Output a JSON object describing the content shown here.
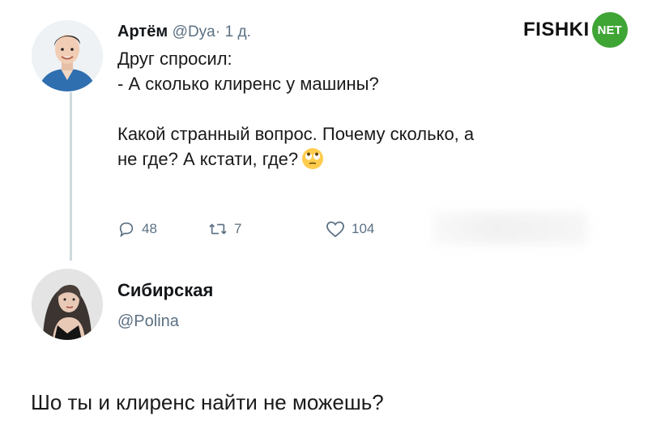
{
  "tweet": {
    "author_name": "Артём",
    "handle": "@Dya",
    "separator": "·",
    "time": "1 д.",
    "lines": [
      "Друг спросил:",
      "- А сколько клиренс у машины?",
      "Какой странный вопрос. Почему сколько, а",
      "не где? А кстати, где?"
    ],
    "emoji_icon": "face-with-rolling-eyes-icon",
    "stats": {
      "replies": "48",
      "retweets": "7",
      "likes": "104"
    }
  },
  "reply_user": {
    "name": "Сибирская",
    "handle": "@Polina"
  },
  "reply_text": "Шо ты и клиренс найти не можешь?",
  "logo": {
    "word": "FISHKI",
    "badge": "NET",
    "badge_color": "#3fa535"
  },
  "colors": {
    "muted": "#5b7083",
    "thread_line": "#cfd9de"
  }
}
